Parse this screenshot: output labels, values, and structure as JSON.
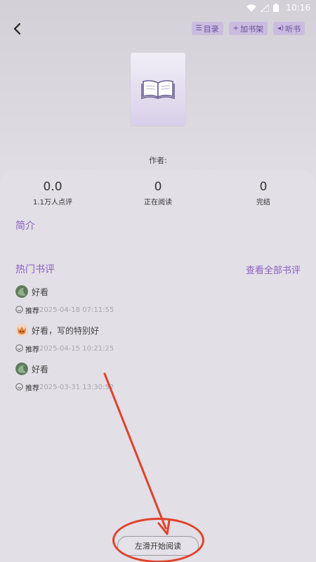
{
  "status_bar": {
    "time": "10:16"
  },
  "toolbar": {
    "catalog_label": "目录",
    "bookshelf_label": "加书架",
    "listen_label": "听书"
  },
  "book": {
    "author_label": "作者:"
  },
  "stats": [
    {
      "value": "0.0",
      "label": "1.1万人点评"
    },
    {
      "value": "0",
      "label": "正在阅读"
    },
    {
      "value": "0",
      "label": "完结"
    }
  ],
  "intro": {
    "title": "简介"
  },
  "reviews": {
    "title": "热门书评",
    "see_all": "查看全部书评",
    "items": [
      {
        "text": "好看",
        "tag": "推荐",
        "date": "2025-04-18 07:11:55"
      },
      {
        "text": "好看，写的特别好",
        "tag": "推荐",
        "date": "2025-04-15 10:21:25"
      },
      {
        "text": "好看",
        "tag": "推荐",
        "date": "2025-03-31 13:30:52"
      }
    ]
  },
  "start_reading": "左滑开始阅读",
  "colors": {
    "accent": "#8a5fc2",
    "annotation": "#e0412b"
  }
}
